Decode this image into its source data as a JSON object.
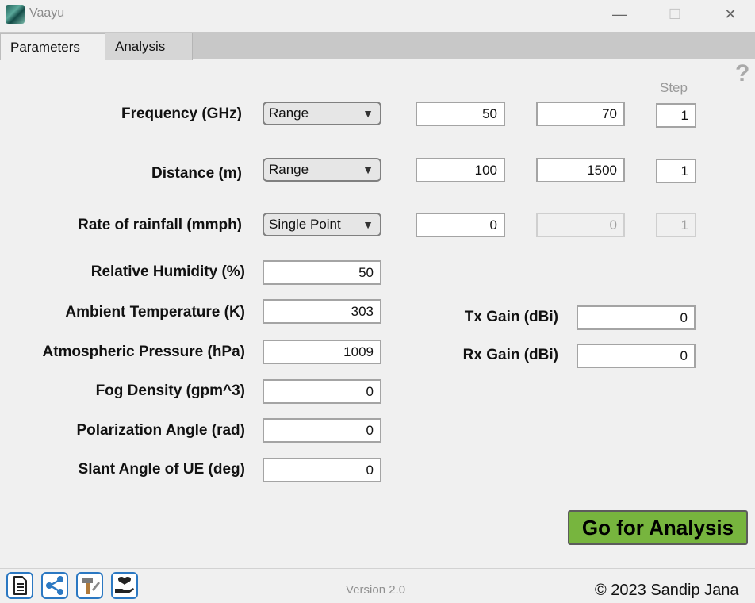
{
  "window": {
    "title": "Vaayu",
    "minimize": "—",
    "maximize": "☐",
    "close": "✕"
  },
  "tabs": [
    {
      "label": "Parameters"
    },
    {
      "label": "Analysis"
    }
  ],
  "help_icon": "?",
  "step_label": "Step",
  "dropdown_arrow": "▼",
  "frequency": {
    "label": "Frequency (GHz)",
    "mode": "Range",
    "start": "50",
    "end": "70",
    "step": "1"
  },
  "distance": {
    "label": "Distance (m)",
    "mode": "Range",
    "start": "100",
    "end": "1500",
    "step": "1"
  },
  "rainfall": {
    "label": "Rate of rainfall (mmph)",
    "mode": "Single Point",
    "start": "0",
    "end": "0",
    "step": "1"
  },
  "humidity": {
    "label": "Relative Humidity (%)",
    "value": "50"
  },
  "temperature": {
    "label": "Ambient Temperature (K)",
    "value": "303"
  },
  "pressure": {
    "label": "Atmospheric Pressure (hPa)",
    "value": "1009"
  },
  "fog": {
    "label": "Fog Density (gpm^3)",
    "value": "0"
  },
  "polarization": {
    "label": "Polarization Angle (rad)",
    "value": "0"
  },
  "slant": {
    "label": "Slant Angle of UE (deg)",
    "value": "0"
  },
  "tx_gain": {
    "label": "Tx Gain (dBi)",
    "value": "0"
  },
  "rx_gain": {
    "label": "Rx Gain (dBi)",
    "value": "0"
  },
  "go_button": "Go for Analysis",
  "toolbar": {
    "icons": [
      "document-icon",
      "share-icon",
      "tools-icon",
      "donate-icon"
    ]
  },
  "footer": {
    "version": "Version 2.0",
    "copyright": "© 2023 Sandip Jana"
  },
  "colors": {
    "go_button": "#77b53e",
    "tool_border": "#2b78c2"
  }
}
